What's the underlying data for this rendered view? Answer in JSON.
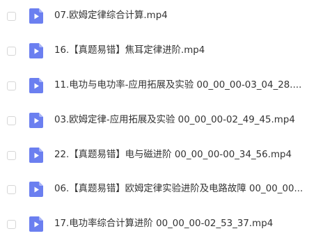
{
  "files": [
    {
      "name": "07.欧姆定律综合计算.mp4",
      "icon": "video-file-icon"
    },
    {
      "name": "16.【真题易错】焦耳定律进阶.mp4",
      "icon": "video-file-icon"
    },
    {
      "name": "11.电功与电功率-应用拓展及实验 00_00_00-03_04_28....",
      "icon": "video-file-icon"
    },
    {
      "name": "03.欧姆定律-应用拓展及实验 00_00_00-02_49_45.mp4",
      "icon": "video-file-icon"
    },
    {
      "name": "22.【真题易错】电与磁进阶 00_00_00-00_34_56.mp4",
      "icon": "video-file-icon"
    },
    {
      "name": "06.【真题易错】欧姆定律实验进阶及电路故障 00_00_00...",
      "icon": "video-file-icon"
    },
    {
      "name": "17.电功率综合计算进阶 00_00_00-02_53_37.mp4",
      "icon": "video-file-icon"
    }
  ],
  "colors": {
    "icon_fill": "#6b7ff0",
    "icon_fold": "#a9b5f7",
    "icon_play": "#ffffff",
    "text": "#333333",
    "checkbox_border": "#d6d6d6"
  }
}
